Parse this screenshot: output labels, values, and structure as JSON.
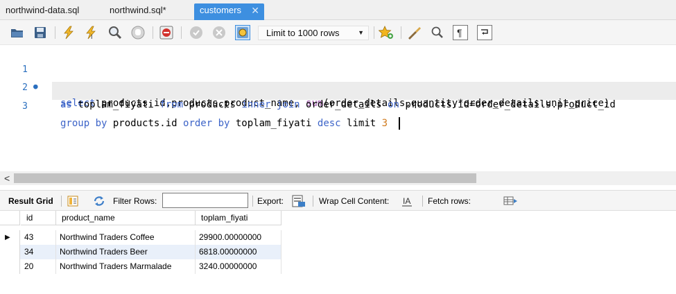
{
  "tabs": [
    {
      "label": "northwind-data.sql"
    },
    {
      "label": "northwind.sql*"
    },
    {
      "label": "customers",
      "close": "✕"
    }
  ],
  "toolbar": {
    "limit_select": {
      "selected": "Limit to 1000 rows"
    },
    "icons": [
      "open-folder-icon",
      "save-icon",
      "execute-icon",
      "execute-current-icon",
      "explain-icon",
      "stop-icon",
      "toggle-error-icon",
      "commit-icon",
      "rollback-icon",
      "autocommit-icon",
      "add-snippet-icon",
      "beautify-icon",
      "find-icon",
      "invisible-chars-icon",
      "wrap-lines-icon"
    ]
  },
  "editor": {
    "lines": [
      {
        "num": "1",
        "marker": "●"
      },
      {
        "num": "2"
      },
      {
        "num": "3"
      }
    ],
    "tokens": {
      "l1_select": "select",
      "l1_cols": " products.id,products.product_name, ",
      "l1_sum": "sum",
      "l1_expr": "(order_details.quantity*order_details.unit_price)",
      "l2_as": "as",
      "l2_alias": " toplam_fiyati ",
      "l2_from": "from",
      "l2_tbl": " products ",
      "l2_join": "inner join",
      "l2_tbl2": " order_details ",
      "l2_on": "on",
      "l2_cond": " products.id=order_details.product_id",
      "l3_group": "group by",
      "l3_col": " products.id ",
      "l3_order": "order by",
      "l3_alias": " toplam_fiyati ",
      "l3_desc": "desc",
      "l3_limit": " limit ",
      "l3_num": "3"
    }
  },
  "scrollbar": {
    "arrow": "<"
  },
  "results_toolbar": {
    "result_grid": "Result Grid",
    "filter_rows": "Filter Rows:",
    "filter_value": "",
    "export": "Export:",
    "wrap_cell": "Wrap Cell Content:",
    "fetch_rows": "Fetch rows:"
  },
  "grid": {
    "columns": [
      "id",
      "product_name",
      "toplam_fiyati"
    ],
    "rows": [
      [
        "43",
        "Northwind Traders Coffee",
        "29900.00000000"
      ],
      [
        "34",
        "Northwind Traders Beer",
        "6818.00000000"
      ],
      [
        "20",
        "Northwind Traders Marmalade",
        "3240.00000000"
      ]
    ],
    "current_row_marker": "▶"
  },
  "colors": {
    "accent_tab": "#3d8fe0",
    "keyword": "#3d64c8",
    "function": "#a35ab0",
    "number": "#d07a1e",
    "line_number": "#2a6fbf"
  }
}
